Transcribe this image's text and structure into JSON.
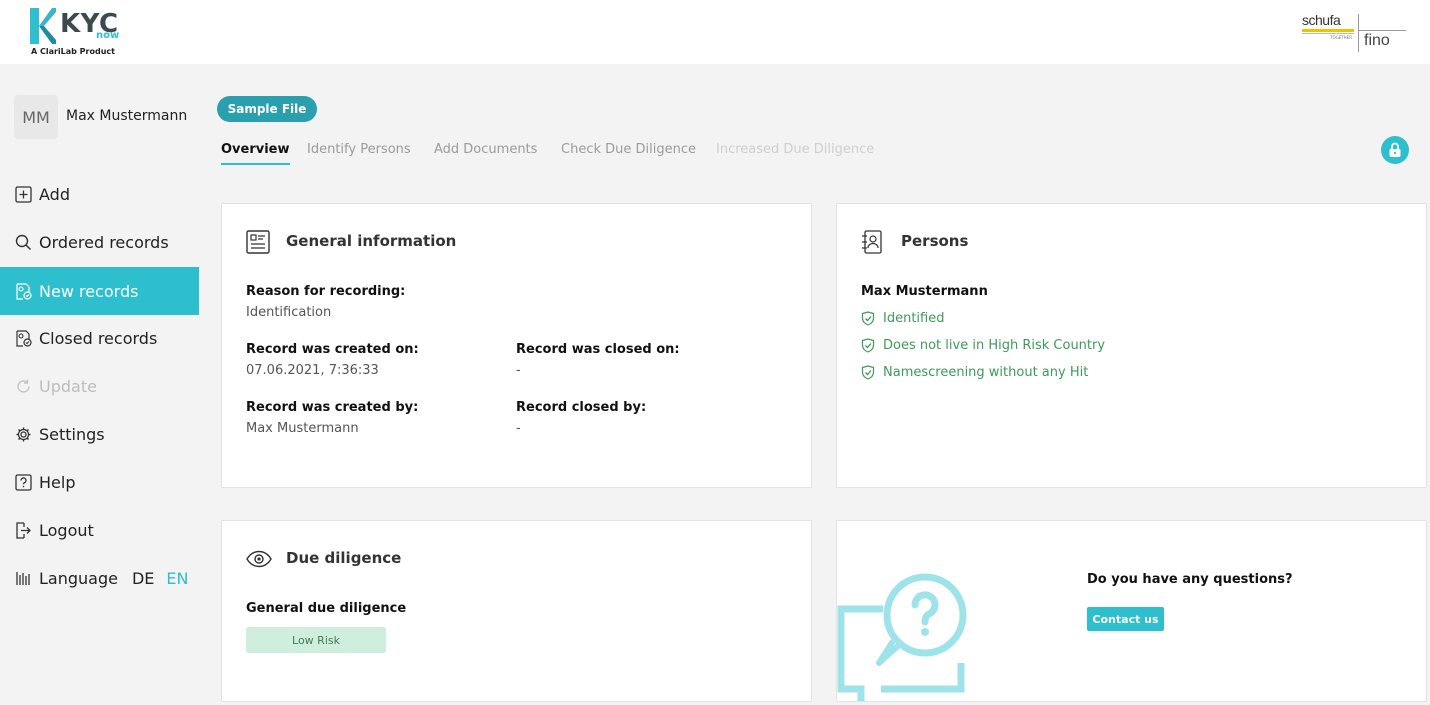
{
  "header": {
    "logo_text": "KYC",
    "logo_sub": "now",
    "logo_tagline": "A ClariLab Product",
    "partner_primary": "schufa",
    "partner_together": "TOGETHER",
    "partner_secondary": "fino"
  },
  "user": {
    "initials": "MM",
    "name": "Max Mustermann"
  },
  "sidebar": {
    "items": [
      {
        "label": "Add"
      },
      {
        "label": "Ordered records"
      },
      {
        "label": "New records"
      },
      {
        "label": "Closed records"
      },
      {
        "label": "Update"
      },
      {
        "label": "Settings"
      },
      {
        "label": "Help"
      },
      {
        "label": "Logout"
      }
    ],
    "language": {
      "label": "Language",
      "de": "DE",
      "en": "EN"
    }
  },
  "file_badge": "Sample File",
  "tabs": [
    {
      "label": "Overview"
    },
    {
      "label": "Identify Persons"
    },
    {
      "label": "Add Documents"
    },
    {
      "label": "Check Due Diligence"
    },
    {
      "label": "Increased Due Diligence"
    }
  ],
  "general": {
    "title": "General information",
    "reason_label": "Reason for recording:",
    "reason_value": "Identification",
    "created_on_label": "Record was created on:",
    "created_on_value": "07.06.2021, 7:36:33",
    "closed_on_label": "Record was closed on:",
    "closed_on_value": "-",
    "created_by_label": "Record was created by:",
    "created_by_value": "Max Mustermann",
    "closed_by_label": "Record closed by:",
    "closed_by_value": "-"
  },
  "persons": {
    "title": "Persons",
    "name": "Max Mustermann",
    "checks": [
      "Identified",
      "Does not live in High Risk Country",
      "Namescreening without any Hit"
    ]
  },
  "due_diligence": {
    "title": "Due diligence",
    "label": "General due diligence",
    "risk": "Low Risk"
  },
  "questions": {
    "title": "Do you have any questions?",
    "button": "Contact us"
  },
  "colors": {
    "accent": "#2dbfcd",
    "badge": "#2a9fae",
    "success": "#3f9a5a",
    "risk_bg": "#cfeedd"
  }
}
